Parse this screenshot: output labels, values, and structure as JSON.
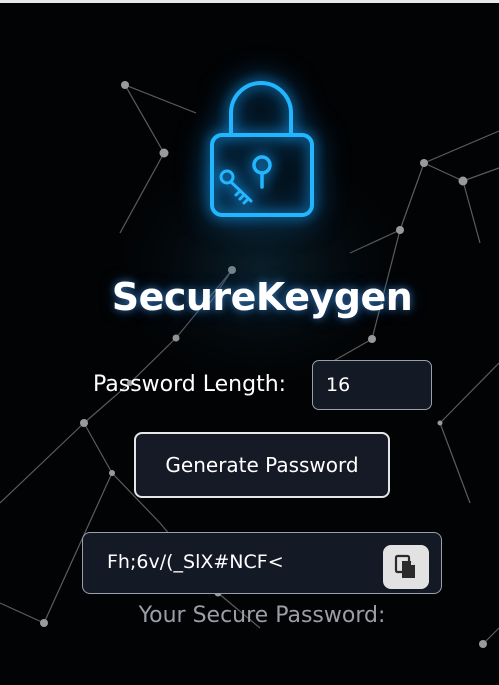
{
  "app": {
    "title": "SecureKeygen"
  },
  "form": {
    "length_label": "Password Length:",
    "length_value": "16",
    "generate_label": "Generate Password"
  },
  "output": {
    "password": "Fh;6v/(_SlX#NCF<",
    "copy_icon": "copy-icon",
    "caption": "Your Secure Password:"
  },
  "colors": {
    "background": "#020304",
    "lock_glow": "#1aa8ff",
    "field_bg": "#141926",
    "caption": "#9b9ea6"
  },
  "icons": {
    "logo": "lock-icon",
    "key": "key-icon",
    "keyhole": "keyhole-icon"
  }
}
